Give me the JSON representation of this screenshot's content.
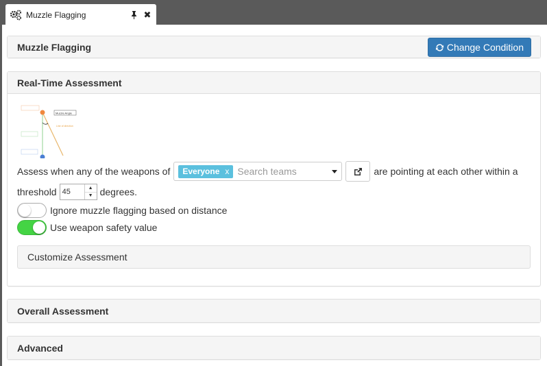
{
  "tab": {
    "title": "Muzzle Flagging"
  },
  "header": {
    "title": "Muzzle Flagging",
    "change_condition_label": "Change Condition"
  },
  "realtime": {
    "title": "Real-Time Assessment",
    "diagram": {
      "labels": [
        "Muzzle Angle",
        "Line of direction"
      ]
    },
    "assess_prefix": "Assess when any of the weapons of",
    "team_tag": "Everyone",
    "team_tag_remove": "x",
    "search_placeholder": "Search teams",
    "assess_suffix": "are pointing at each other within a",
    "threshold_label": "threshold",
    "threshold_value": "45",
    "degrees_label": "degrees.",
    "ignore_distance_label": "Ignore muzzle flagging based on distance",
    "ignore_distance_on": false,
    "weapon_safety_label": "Use weapon safety value",
    "weapon_safety_on": true,
    "customize_label": "Customize Assessment"
  },
  "overall": {
    "title": "Overall Assessment"
  },
  "advanced": {
    "title": "Advanced"
  },
  "colors": {
    "primary": "#337ab7",
    "toggle_on": "#44d444",
    "tag": "#5bc0de"
  }
}
